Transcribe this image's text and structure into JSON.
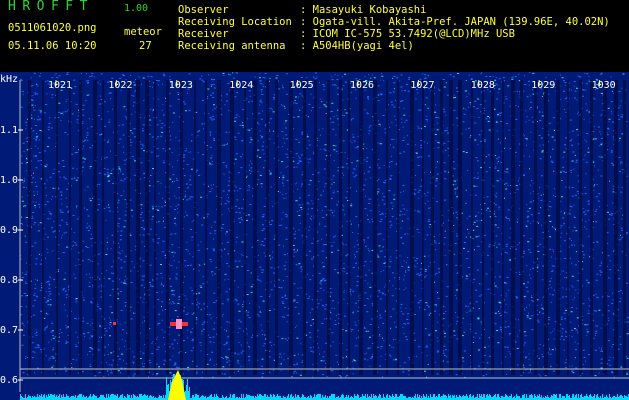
{
  "header": {
    "app_title": "HROFFT",
    "app_version": "1.00",
    "file_name": "0511061020.png",
    "datetime": "05.11.06 10:20",
    "meteor_label": "meteor",
    "meteor_count": "27",
    "info": [
      {
        "label": "Observer",
        "value": ": Masayuki Kobayashi"
      },
      {
        "label": "Receiving Location",
        "value": ": Ogata-vill. Akita-Pref. JAPAN (139.96E, 40.02N)"
      },
      {
        "label": "Receiver",
        "value": ": ICOM IC-575 53.7492(@LCD)MHz USB"
      },
      {
        "label": "Receiving antenna",
        "value": ": A504HB(yagi 4el)"
      }
    ]
  },
  "spectrogram": {
    "y_unit": "kHz",
    "y_ticks": [
      "1.1",
      "1.0",
      "0.9",
      "0.8",
      "0.7",
      "0.6"
    ],
    "x_ticks": [
      "1021",
      "1022",
      "1023",
      "1024",
      "1025",
      "1026",
      "1027",
      "1028",
      "1029",
      "1030"
    ],
    "colors": {
      "background": "#001a78",
      "noise": "#1e6aff",
      "bright": "#38e0c8",
      "grid": "#bfbfbf",
      "tick": "#ffff00",
      "signal": "#ff3030",
      "level": "#00d8ff"
    }
  }
}
